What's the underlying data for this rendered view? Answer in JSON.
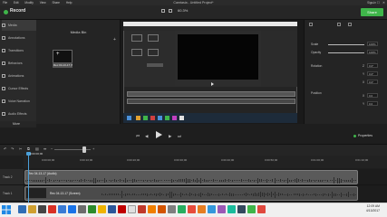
{
  "menu": {
    "items": [
      "File",
      "Edit",
      "Modify",
      "View",
      "Share",
      "Help"
    ],
    "window_title": "Camtasia - Untitled Project*",
    "sign_in": "Sign In",
    "window_controls": "— ☐ ✕"
  },
  "toolbar": {
    "app_name": "Record",
    "zoom": "60.3%",
    "share_label": "Share",
    "brand_color": "#3fb54a"
  },
  "sidebar": {
    "items": [
      {
        "label": "Media",
        "icon": "media-icon"
      },
      {
        "label": "Annotations",
        "icon": "annotations-icon"
      },
      {
        "label": "Transitions",
        "icon": "transitions-icon"
      },
      {
        "label": "Behaviors",
        "icon": "behaviors-icon"
      },
      {
        "label": "Animations",
        "icon": "animations-icon"
      },
      {
        "label": "Cursor Effects",
        "icon": "cursor-effects-icon"
      },
      {
        "label": "Voice Narration",
        "icon": "voice-narration-icon"
      },
      {
        "label": "Audio Effects",
        "icon": "audio-effects-icon"
      }
    ],
    "more_label": "More"
  },
  "media_bin": {
    "title": "Media Bin",
    "clip_label": "Rec 04-13-17 (Screen)"
  },
  "properties": {
    "scale_label": "Scale",
    "scale_value": "100%",
    "opacity_label": "Opacity",
    "opacity_value": "100%",
    "rotation_label": "Rotation",
    "rotation_values": [
      "0.0°",
      "0.0°",
      "0.0°"
    ],
    "axis_labels": [
      "Z",
      "Y",
      "X"
    ],
    "position_label": "Position",
    "position_values": [
      "0.0",
      "0.0"
    ],
    "position_axes": [
      "X",
      "Y"
    ]
  },
  "playback": {
    "properties_label": "Properties"
  },
  "timeline": {
    "playhead_time": "0:00:00;00",
    "ruler_ticks": [
      "0:00:00;00",
      "0:00:10;00",
      "0:00:20;00",
      "0:00:30;00",
      "0:00:40;00",
      "0:00:50;00",
      "0:01:00;00",
      "0:01:10;00"
    ],
    "tracks": [
      {
        "label": "Track 2",
        "clip": "Rec 04-13-17 (Audio)"
      },
      {
        "label": "Track 1",
        "clip": "Rec 04-13-17 (Screen)"
      }
    ]
  },
  "taskbar": {
    "time": "12:09 AM",
    "date": "4/13/2017"
  }
}
